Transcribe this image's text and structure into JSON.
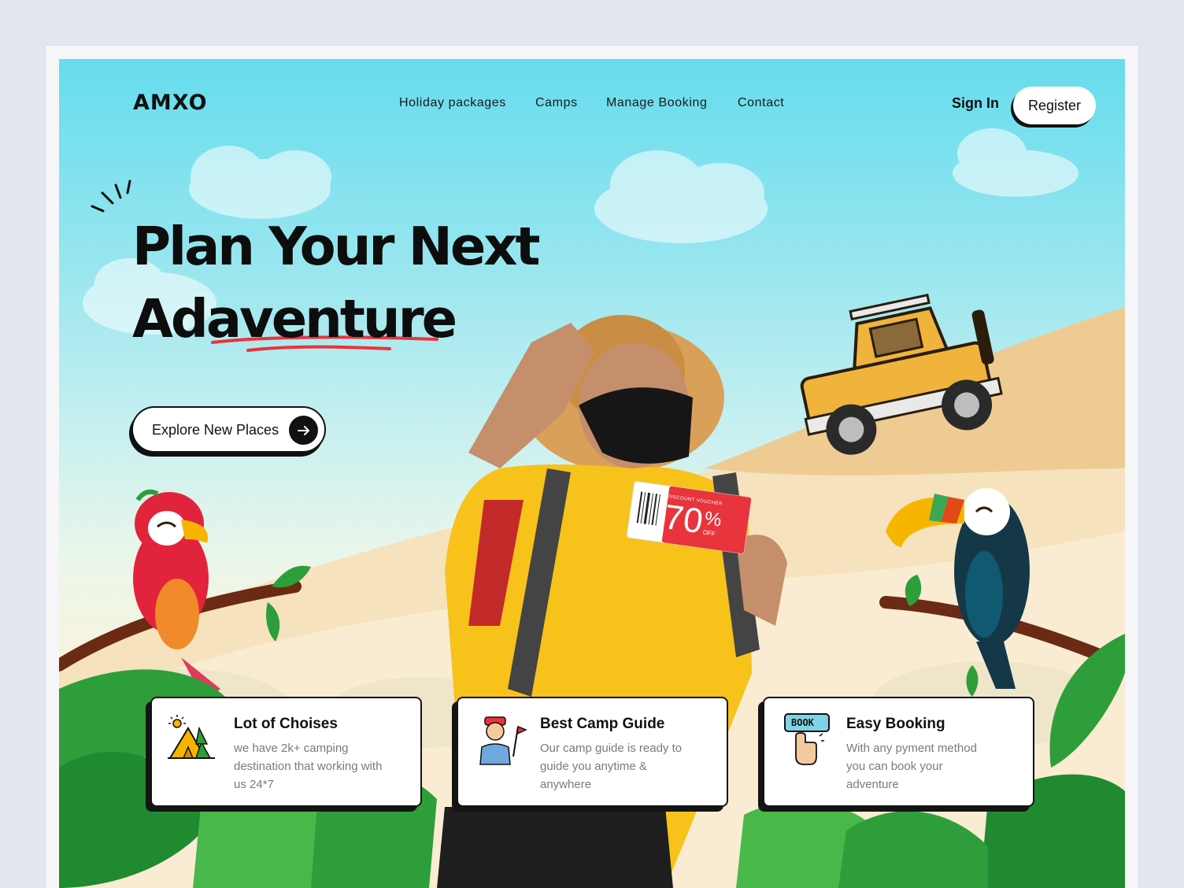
{
  "nav": {
    "logo": "AMXO",
    "links": [
      "Holiday packages",
      "Camps",
      "Manage Booking",
      "Contact"
    ],
    "sign_in": "Sign In",
    "register": "Register"
  },
  "hero": {
    "headline_line1": "Plan Your Next",
    "headline_line2": "Adaventure",
    "cta_label": "Explore New Places",
    "voucher": {
      "label": "DISCOUNT VOUCHER",
      "value": "70",
      "percent": "%",
      "off": "OFF"
    }
  },
  "features": [
    {
      "title": "Lot of Choises",
      "line1": "we have 2k+ camping",
      "line2": "destination that working with",
      "line3": "us 24*7",
      "icon": "camping-tent-icon"
    },
    {
      "title": "Best Camp Guide",
      "line1": "Our camp guide is ready to",
      "line2": "guide you anytime &",
      "line3": "anywhere",
      "icon": "camp-guide-icon"
    },
    {
      "title": "Easy Booking",
      "line1": "With any pyment method",
      "line2": "you can book your",
      "line3": "adventure",
      "icon": "book-button-icon",
      "icon_text": "BOOK"
    }
  ],
  "colors": {
    "sky_top": "#66dced",
    "sand": "#f4dcb0",
    "accent_red": "#e8343c",
    "jeep_yellow": "#f0b43c",
    "shirt_yellow": "#f7c21a",
    "leaf_green": "#2e9e3a"
  }
}
